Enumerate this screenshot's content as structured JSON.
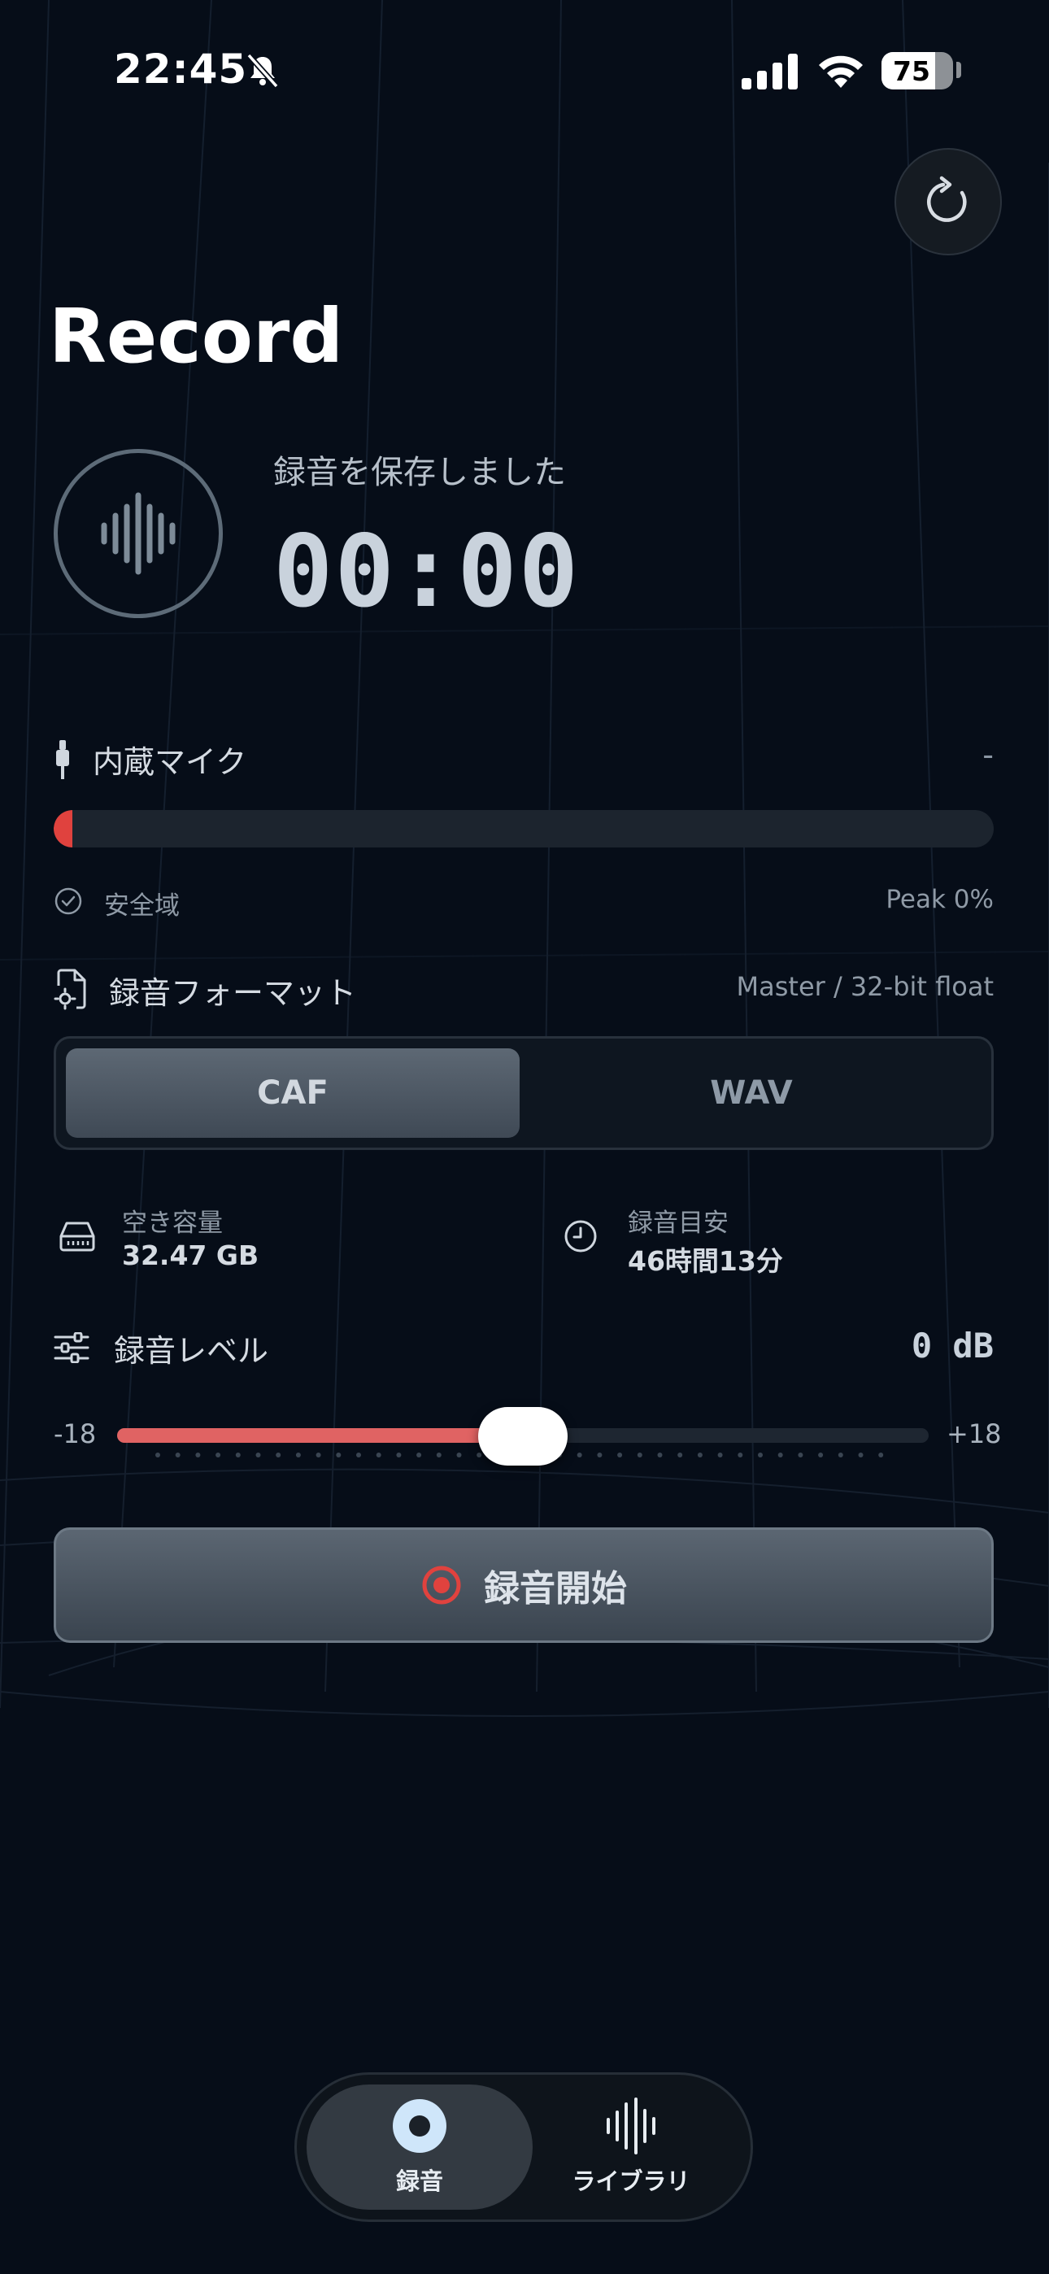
{
  "status_bar": {
    "time": "22:45",
    "battery": "75",
    "icons": [
      "bell-slash-icon",
      "cellular-signal-icon",
      "wifi-icon",
      "battery-icon"
    ]
  },
  "header": {
    "title": "Record",
    "refresh_icon": "refresh-icon"
  },
  "recorder": {
    "status": "録音を保存しました",
    "timer": "00:00",
    "waveform_icon": "waveform-icon"
  },
  "input": {
    "mic_name": "内蔵マイク",
    "mic_value": "-",
    "meter_level": 0.02,
    "safe_label": "安全域",
    "peak_label": "Peak 0%"
  },
  "format": {
    "label": "録音フォーマット",
    "detail": "Master / 32-bit float",
    "options": [
      "CAF",
      "WAV"
    ],
    "selected": "CAF"
  },
  "storage": {
    "free_label": "空き容量",
    "free_value": "32.47 GB",
    "estimate_label": "録音目安",
    "estimate_value": "46時間13分"
  },
  "level": {
    "label": "録音レベル",
    "value_display": "0 dB",
    "min_label": "-18",
    "max_label": "+18",
    "value": 0,
    "min": -18,
    "max": 18
  },
  "record_button": {
    "label": "録音開始"
  },
  "tabs": [
    {
      "label": "録音",
      "icon": "record-icon",
      "active": true
    },
    {
      "label": "ライブラリ",
      "icon": "waveform-icon",
      "active": false
    }
  ],
  "colors": {
    "background": "#060d18",
    "accent_red": "#e0423e",
    "slider_red": "#e06363",
    "panel": "#1c242e"
  }
}
